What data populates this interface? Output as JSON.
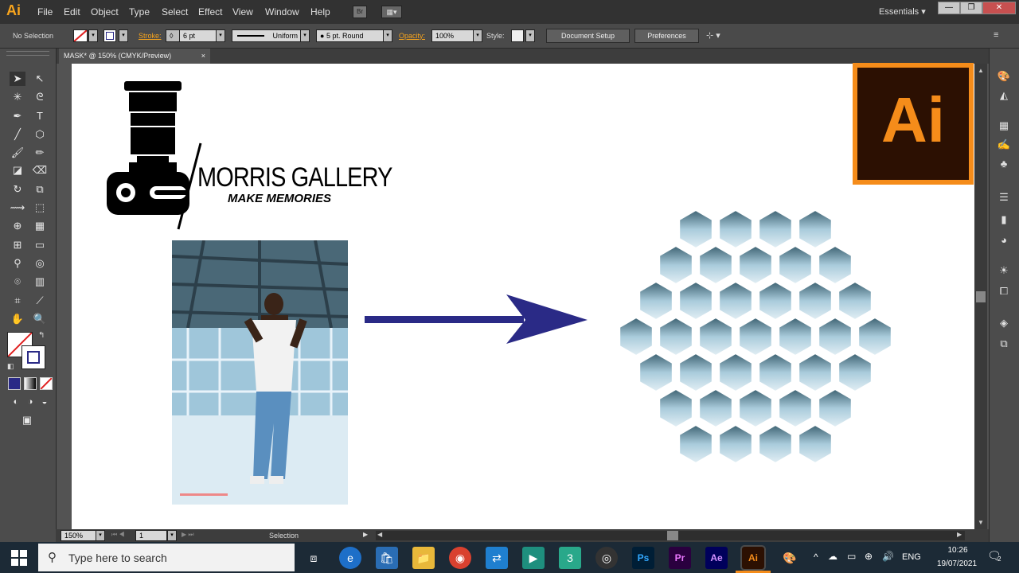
{
  "app": {
    "logo": "Ai",
    "workspace": "Essentials"
  },
  "menu": [
    "File",
    "Edit",
    "Object",
    "Type",
    "Select",
    "Effect",
    "View",
    "Window",
    "Help"
  ],
  "menubar_extra": {
    "bridge": "Br"
  },
  "window_controls": {
    "minimize": "—",
    "restore": "❐",
    "close": "✕"
  },
  "control_bar": {
    "selection_status": "No Selection",
    "stroke_label": "Stroke:",
    "stroke_value": "6 pt",
    "profile": "Uniform",
    "brush": "5 pt. Round",
    "opacity_label": "Opacity:",
    "opacity_value": "100%",
    "style_label": "Style:",
    "document_setup": "Document Setup",
    "preferences": "Preferences"
  },
  "document_tab": {
    "title": "MASK* @ 150% (CMYK/Preview)",
    "close": "×"
  },
  "artwork": {
    "brand_name": "MORRIS GALLERY",
    "tagline": "MAKE MEMORIES",
    "ai_badge": "Ai"
  },
  "status_bar": {
    "zoom": "150%",
    "artboard": "1",
    "tool": "Selection"
  },
  "taskbar": {
    "search_placeholder": "Type here to search",
    "language": "ENG",
    "time": "10:26",
    "date": "19/07/2021",
    "notifications": "2",
    "apps": [
      "Ps",
      "Pr",
      "Ae",
      "Ai"
    ]
  },
  "colors": {
    "accent_orange": "#f58c1a",
    "arrow_blue": "#2a2a86",
    "ai_dark": "#2c1002"
  }
}
